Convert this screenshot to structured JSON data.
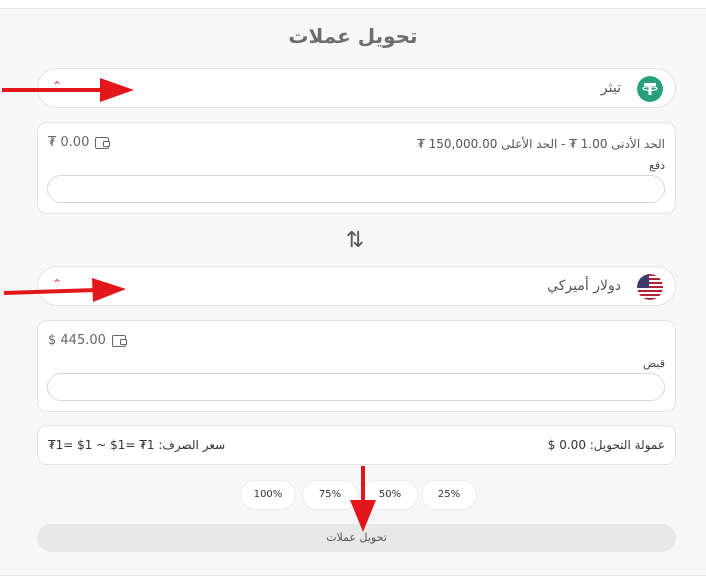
{
  "page": {
    "title": "تحويل عملات"
  },
  "from": {
    "currency_label": "تيثر",
    "icon": "tether-icon",
    "icon_color": "#26a17b",
    "limits_text": "الحد الأدنى 1.00 ₮  -  الحد الأعلى 150,000.00 ₮",
    "balance": "₮ 0.00",
    "field_label": "دفع",
    "field_value": ""
  },
  "to": {
    "currency_label": "دولار أميركي",
    "icon": "us-flag-icon",
    "balance": "$ 445.00",
    "field_label": "قبض",
    "field_value": ""
  },
  "info": {
    "commission": "عمولة التحويل: 0.00 $",
    "rate": "سعر الصرف: 1₮ =1$ ~ 1$ =1₮"
  },
  "percent_buttons": [
    "25%",
    "50%",
    "75%",
    "100%"
  ],
  "submit_label": "تحويل عملات",
  "annotation_color": "#e3171b"
}
